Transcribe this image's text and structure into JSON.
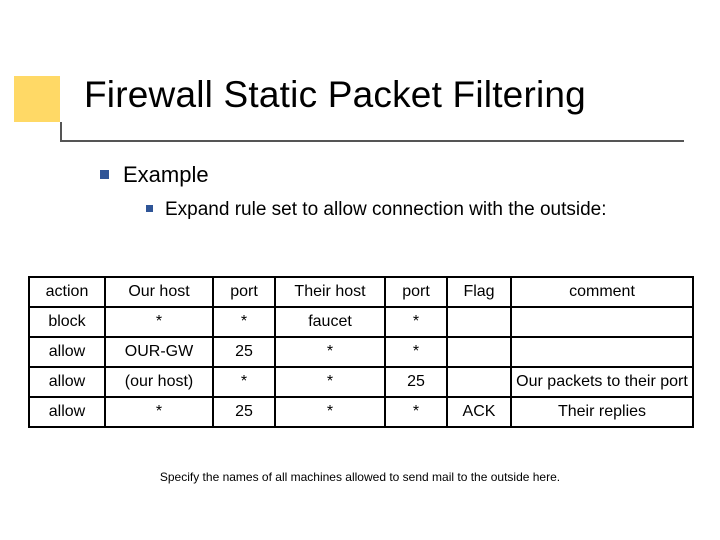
{
  "title": "Firewall Static Packet Filtering",
  "bullet_level1": "Example",
  "bullet_level2": "Expand rule set to allow connection with the outside:",
  "table": {
    "headers": [
      "action",
      "Our host",
      "port",
      "Their host",
      "port",
      "Flag",
      "comment"
    ],
    "rows": [
      {
        "c0": "block",
        "c1": "*",
        "c2": "*",
        "c3": "faucet",
        "c4": "*",
        "c5": "",
        "c6": ""
      },
      {
        "c0": "allow",
        "c1": "OUR-GW",
        "c2": "25",
        "c3": "*",
        "c4": "*",
        "c5": "",
        "c6": ""
      },
      {
        "c0": "allow",
        "c1": "(our host)",
        "c2": "*",
        "c3": "*",
        "c4": "25",
        "c5": "",
        "c6": "Our packets to their port"
      },
      {
        "c0": "allow",
        "c1": "*",
        "c2": "25",
        "c3": "*",
        "c4": "*",
        "c5": "ACK",
        "c6": "Their replies"
      }
    ]
  },
  "footnote": "Specify the names of all machines allowed to send mail to the outside here."
}
